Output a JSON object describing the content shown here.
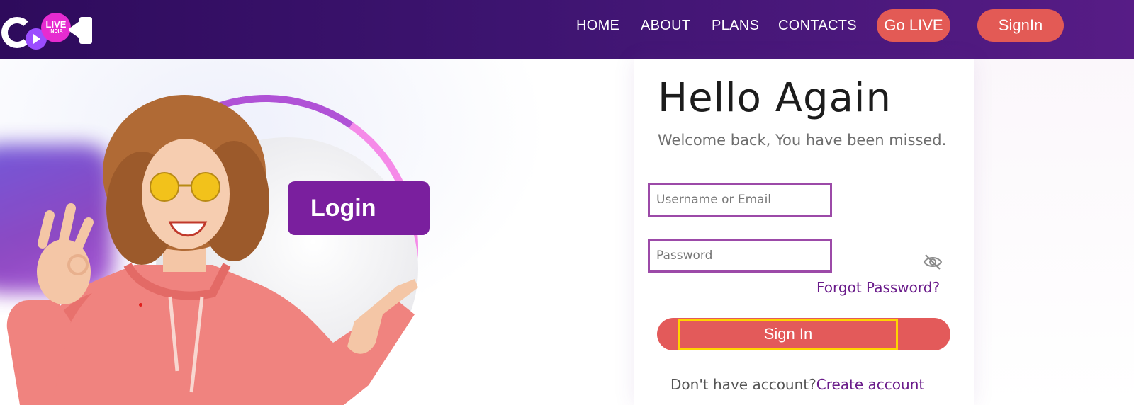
{
  "brand": {
    "logo_text_top": "LIVE",
    "logo_text_bottom": "INDIA"
  },
  "nav": {
    "items": [
      {
        "label": "HOME"
      },
      {
        "label": "ABOUT"
      },
      {
        "label": "PLANS"
      },
      {
        "label": "CONTACTS"
      }
    ],
    "go_live": "Go LIVE",
    "signin": "SignIn"
  },
  "hero": {
    "badge": "Login"
  },
  "login": {
    "title": "Hello Again",
    "subtitle": "Welcome back, You have been missed.",
    "username_placeholder": "Username or Email",
    "password_placeholder": "Password",
    "forgot": "Forgot Password?",
    "submit": "Sign In",
    "no_account": "Don't have account?",
    "create_account": "Create account"
  },
  "colors": {
    "header_start": "#2e0b5c",
    "header_end": "#571c86",
    "accent": "#e35a55",
    "purple": "#7a1f9e",
    "field_border": "#9c4aa8",
    "highlight": "#ffd400"
  },
  "icons": [
    "play-icon",
    "camera-icon",
    "eye-off-icon"
  ]
}
